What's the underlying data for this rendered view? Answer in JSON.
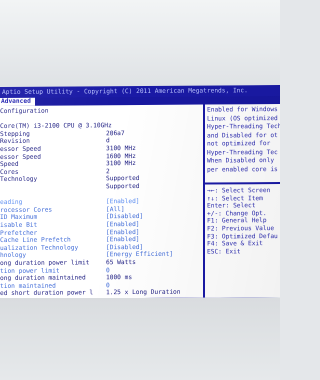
{
  "title_bar": "Aptio Setup Utility - Copyright (C) 2011 American Megatrends, Inc.",
  "tab": "Advanced",
  "rows": [
    {
      "label": "Configuration",
      "value": "",
      "type": "info"
    },
    {
      "label": "",
      "value": "",
      "type": "blank"
    },
    {
      "label": "Core(TM) i3-2100 CPU @ 3.10GHz",
      "value": "",
      "type": "info"
    },
    {
      "label": "Stepping",
      "value": "206a7",
      "type": "info"
    },
    {
      "label": "Revision",
      "value": "d",
      "type": "info"
    },
    {
      "label": "essor Speed",
      "value": "3100 MHz",
      "type": "info"
    },
    {
      "label": "essor Speed",
      "value": "1600 MHz",
      "type": "info"
    },
    {
      "label": "Speed",
      "value": "3100 MHz",
      "type": "info"
    },
    {
      "label": "Cores",
      "value": "2",
      "type": "info"
    },
    {
      "label": "Technology",
      "value": "Supported",
      "type": "info"
    },
    {
      "label": "",
      "value": "Supported",
      "type": "info"
    },
    {
      "label": "",
      "value": "",
      "type": "blank"
    },
    {
      "label": "eading",
      "value": "[Enabled]",
      "type": "highlight"
    },
    {
      "label": "rocessor Cores",
      "value": "[All]",
      "type": "option"
    },
    {
      "label": "ID Maximum",
      "value": "[Disabled]",
      "type": "option"
    },
    {
      "label": "isable Bit",
      "value": "[Enabled]",
      "type": "option"
    },
    {
      "label": "Prefetcher",
      "value": "[Enabled]",
      "type": "option"
    },
    {
      "label": "Cache Line Prefetch",
      "value": "[Enabled]",
      "type": "option"
    },
    {
      "label": "ualization Technology",
      "value": "[Disabled]",
      "type": "option"
    },
    {
      "label": "hnology",
      "value": "[Energy Efficient]",
      "type": "option"
    },
    {
      "label": "ong duration power limit",
      "value": "65 Watts",
      "type": "info"
    },
    {
      "label": "tion power limit",
      "value": "0",
      "type": "option"
    },
    {
      "label": "ong duration maintained",
      "value": "1000 ms",
      "type": "info"
    },
    {
      "label": "tion maintained",
      "value": "0",
      "type": "option"
    },
    {
      "label": "ed short duration power l",
      "value": "1.25 x Long Duration",
      "type": "info"
    }
  ],
  "help_lines": [
    "Enabled for Windows",
    "Linux (OS optimized",
    "Hyper-Threading Tech",
    "and Disabled for ot",
    "not optimized for",
    "Hyper-Threading Tec",
    "When Disabled only",
    "per enabled core is"
  ],
  "key_lines": [
    "→←: Select Screen",
    "↑↓: Select Item",
    "Enter: Select",
    "+/-: Change Opt.",
    "F1: General Help",
    "F2: Previous Value",
    "F3: Optimized Defau",
    "F4: Save & Exit",
    "ESC: Exit"
  ]
}
